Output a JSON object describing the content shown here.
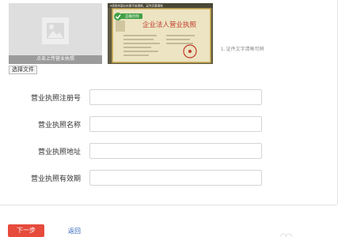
{
  "upload": {
    "caption": "点击上传营业执照",
    "file_button": "选择文件"
  },
  "example": {
    "badge": "正确示例",
    "top_banner": "●请保持营业执照字迹清晰，证件完整清晰",
    "title": "企业法人营业执照"
  },
  "hint": "1. 证件文字清晰可辨",
  "form": {
    "fields": [
      {
        "label": "营业执照注册号",
        "value": ""
      },
      {
        "label": "营业执照名称",
        "value": ""
      },
      {
        "label": "营业执照地址",
        "value": ""
      },
      {
        "label": "营业执照有效期",
        "value": ""
      }
    ]
  },
  "actions": {
    "next_label": "下一步",
    "back_label": "返回"
  },
  "colors": {
    "primary": "#e64b3c",
    "link": "#2b5fb8",
    "example_badge": "#43a047"
  }
}
